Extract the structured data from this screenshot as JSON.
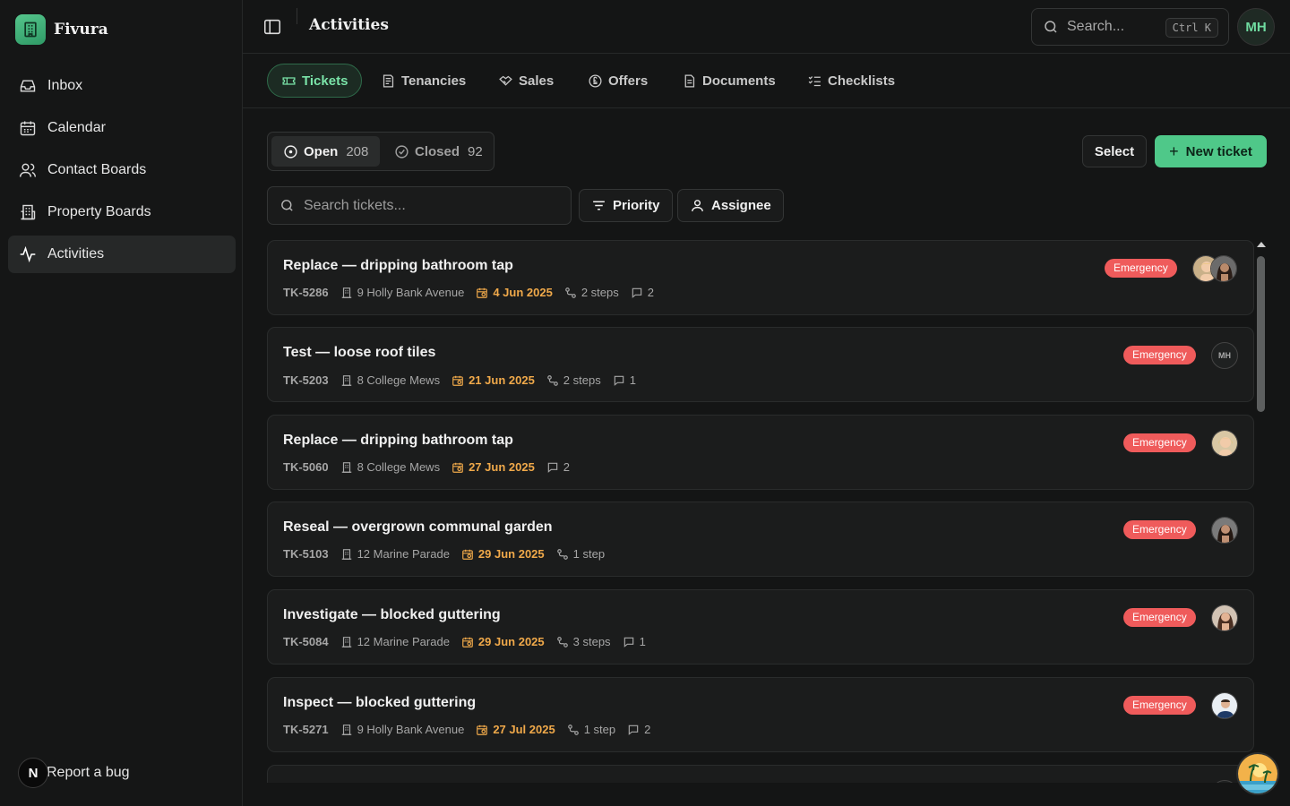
{
  "app": {
    "name": "Fivura",
    "page_title": "Activities"
  },
  "sidebar": {
    "items": [
      {
        "label": "Inbox",
        "icon": "inbox-icon"
      },
      {
        "label": "Calendar",
        "icon": "calendar-icon"
      },
      {
        "label": "Contact Boards",
        "icon": "users-icon"
      },
      {
        "label": "Property Boards",
        "icon": "building-icon"
      },
      {
        "label": "Activities",
        "icon": "activity-icon",
        "active": true
      }
    ],
    "report_bug": "Report a bug",
    "report_badge": "N"
  },
  "header": {
    "search_placeholder": "Search...",
    "search_shortcut": "Ctrl K",
    "user_initials": "MH"
  },
  "tabs": [
    {
      "label": "Tickets",
      "icon": "ticket-icon",
      "active": true
    },
    {
      "label": "Tenancies",
      "icon": "receipt-icon"
    },
    {
      "label": "Sales",
      "icon": "handshake-icon"
    },
    {
      "label": "Offers",
      "icon": "pound-coin-icon"
    },
    {
      "label": "Documents",
      "icon": "document-icon"
    },
    {
      "label": "Checklists",
      "icon": "checklist-icon"
    }
  ],
  "toolbar": {
    "open_label": "Open",
    "open_count": "208",
    "closed_label": "Closed",
    "closed_count": "92",
    "select_label": "Select",
    "new_ticket_label": "New ticket",
    "ticket_search_placeholder": "Search tickets...",
    "priority_label": "Priority",
    "assignee_label": "Assignee"
  },
  "tickets": [
    {
      "title": "Replace — dripping bathroom tap",
      "id": "TK-5286",
      "property": "9 Holly Bank Avenue",
      "date": "4 Jun 2025",
      "steps": "2 steps",
      "comments": "2",
      "priority": "Emergency",
      "assignees": [
        "photo-blonde",
        "photo-dark"
      ]
    },
    {
      "title": "Test — loose roof tiles",
      "id": "TK-5203",
      "property": "8 College Mews",
      "date": "21 Jun 2025",
      "steps": "2 steps",
      "comments": "1",
      "priority": "Emergency",
      "assignee_initials": "MH"
    },
    {
      "title": "Replace — dripping bathroom tap",
      "id": "TK-5060",
      "property": "8 College Mews",
      "date": "27 Jun 2025",
      "comments": "2",
      "priority": "Emergency",
      "assignees": [
        "photo-blonde"
      ]
    },
    {
      "title": "Reseal — overgrown communal garden",
      "id": "TK-5103",
      "property": "12 Marine Parade",
      "date": "29 Jun 2025",
      "steps": "1 step",
      "priority": "Emergency",
      "assignees": [
        "photo-dark"
      ]
    },
    {
      "title": "Investigate — blocked guttering",
      "id": "TK-5084",
      "property": "12 Marine Parade",
      "date": "29 Jun 2025",
      "steps": "3 steps",
      "comments": "1",
      "priority": "Emergency",
      "assignees": [
        "photo-brunette"
      ]
    },
    {
      "title": "Inspect — blocked guttering",
      "id": "TK-5271",
      "property": "9 Holly Bank Avenue",
      "date": "27 Jul 2025",
      "steps": "1 step",
      "comments": "2",
      "priority": "Emergency",
      "assignees": [
        "photo-man"
      ]
    }
  ],
  "colors": {
    "accent": "#4fc889",
    "emergency": "#ef5b5b",
    "date": "#f0a94a",
    "background": "#141515"
  }
}
